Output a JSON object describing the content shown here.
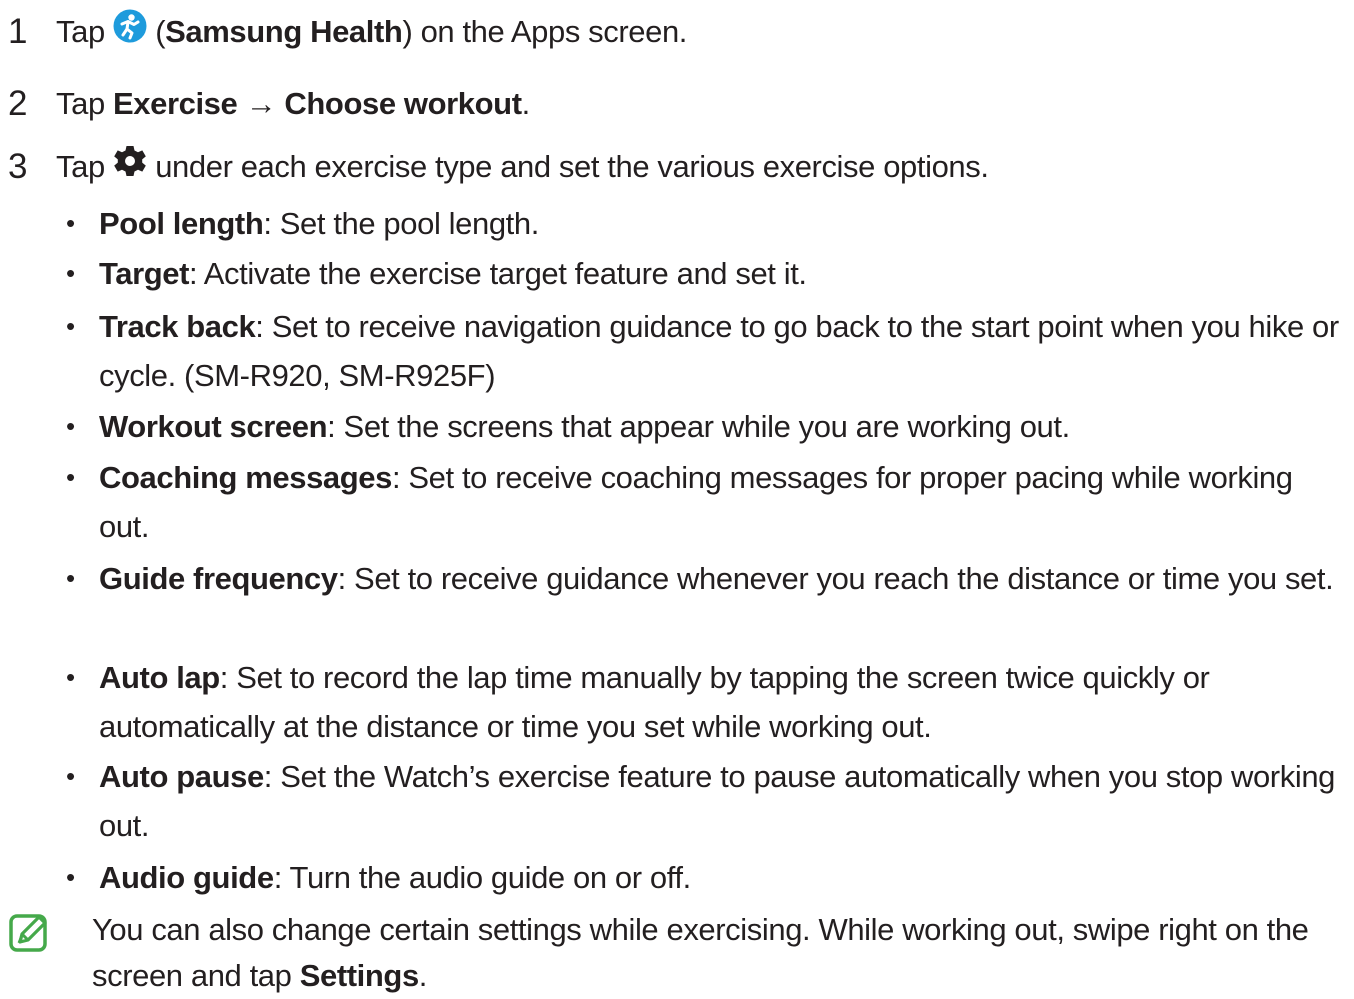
{
  "steps": [
    {
      "number": "1",
      "before": "Tap ",
      "icon": "samsung-health-app-icon",
      "paren_open": " (",
      "bold": "Samsung Health",
      "after": ") on the Apps screen."
    },
    {
      "number": "2",
      "before": "Tap ",
      "bold1": "Exercise",
      "arrow": " → ",
      "bold2": "Choose workout",
      "after": "."
    },
    {
      "number": "3",
      "before": "Tap ",
      "icon": "gear-icon",
      "after": " under each exercise type and set the various exercise options."
    }
  ],
  "options": [
    {
      "label": "Pool length",
      "desc": ": Set the pool length."
    },
    {
      "label": "Target",
      "desc": ": Activate the exercise target feature and set it."
    },
    {
      "label": "Track back",
      "desc": ": Set to receive navigation guidance to go back to the start point when you hike or cycle. (SM-R920, SM-R925F)"
    },
    {
      "label": "Workout screen",
      "desc": ": Set the screens that appear while you are working out."
    },
    {
      "label": "Coaching messages",
      "desc": ": Set to receive coaching messages for proper pacing while working out."
    },
    {
      "label": "Guide frequency",
      "desc": ": Set to receive guidance whenever you reach the distance or time you set."
    },
    {
      "label": "Auto lap",
      "desc": ": Set to record the lap time manually by tapping the screen twice quickly or automatically at the distance or time you set while working out."
    },
    {
      "label": "Auto pause",
      "desc": ": Set the Watch’s exercise feature to pause automatically when you stop working out."
    },
    {
      "label": "Audio guide",
      "desc": ": Turn the audio guide on or off."
    }
  ],
  "bullet_char": "•",
  "note": {
    "icon": "note-pencil-icon",
    "text": "You can also change certain settings while exercising. While working out, swipe right on the screen and tap ",
    "bold": "Settings",
    "after": "."
  },
  "colors": {
    "text": "#231f20",
    "health_icon_bg": "#1e9bdc",
    "note_icon": "#45a94a"
  }
}
